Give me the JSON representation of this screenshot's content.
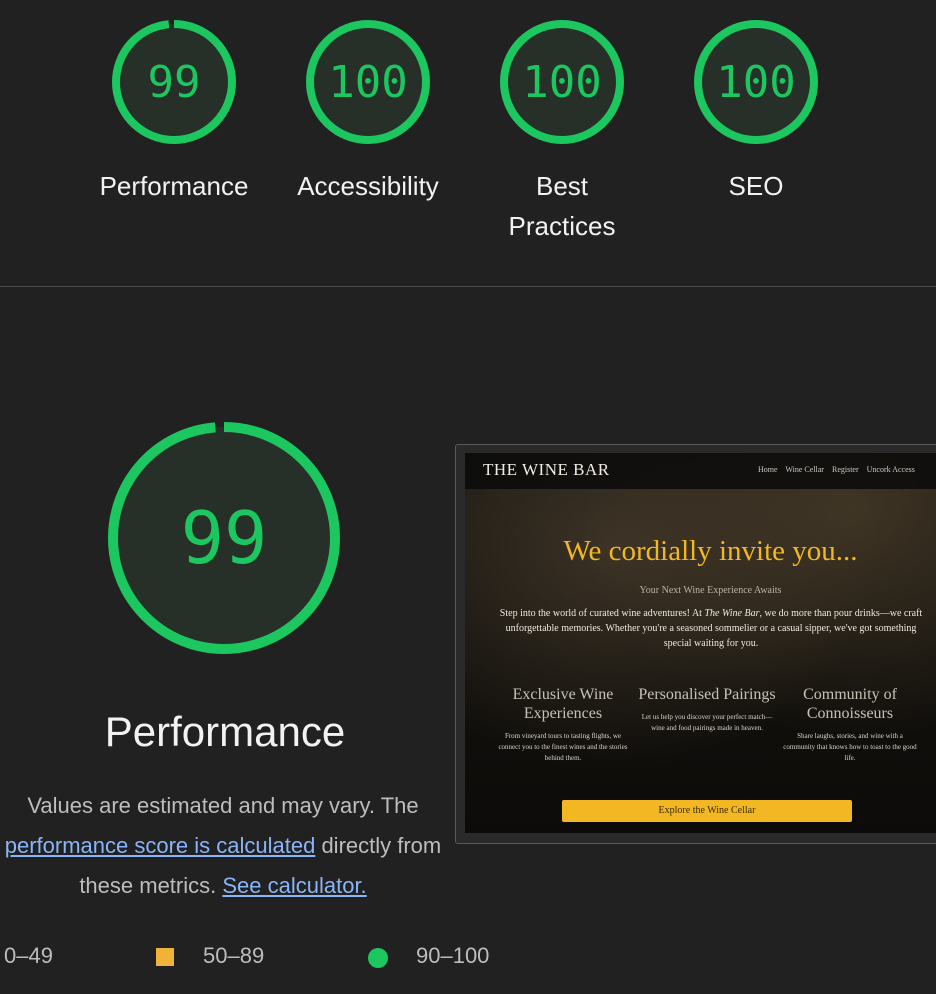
{
  "summary": [
    {
      "score": "99",
      "label": "Performance",
      "fraction": 0.99
    },
    {
      "score": "100",
      "label": "Accessibility",
      "fraction": 1.0
    },
    {
      "score": "100",
      "label": "Best Practices",
      "fraction": 1.0
    },
    {
      "score": "100",
      "label": "SEO",
      "fraction": 1.0
    }
  ],
  "main": {
    "score": "99",
    "fraction": 0.99,
    "title": "Performance",
    "desc_prefix": "Values are estimated and may vary. The ",
    "desc_link": "performance score is calculated",
    "desc_middle": " directly from these metrics. ",
    "desc_calc_link": "See calculator."
  },
  "legend": {
    "fail": "0–49",
    "average": "50–89",
    "pass": "90–100"
  },
  "colors": {
    "pass": "#1cc760",
    "average": "#f0b33a",
    "gauge_fill": "#262f28",
    "background": "#212121"
  },
  "screenshot": {
    "brand": "THE WINE BAR",
    "nav": [
      "Home",
      "Wine Cellar",
      "Register",
      "Uncork Access"
    ],
    "hero": "We cordially invite you...",
    "subtitle": "Your Next Wine Experience Awaits",
    "para_start": "Step into the world of curated wine adventures! At ",
    "para_brand": "The Wine Bar",
    "para_end": ", we do more than pour drinks—we craft unforgettable memories. Whether you're a seasoned sommelier or a casual sipper, we've got something special waiting for you.",
    "features": [
      {
        "title": "Exclusive Wine Experiences",
        "body": "From vineyard tours to tasting flights, we connect you to the finest wines and the stories behind them."
      },
      {
        "title": "Personalised Pairings",
        "body": "Let us help you discover your perfect match—wine and food pairings made in heaven."
      },
      {
        "title": "Community of Connoisseurs",
        "body": "Share laughs, stories, and wine with a community that knows how to toast to the good life."
      }
    ],
    "cta": "Explore the Wine Cellar"
  }
}
